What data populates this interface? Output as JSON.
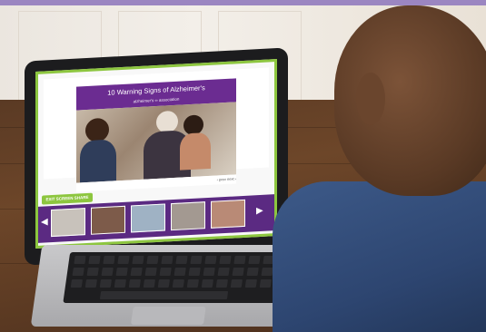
{
  "slide": {
    "title": "10 Warning Signs of Alzheimer's",
    "logo_text": "alzheimer's ∞ association",
    "footer": "‹ prev   next ›"
  },
  "controls": {
    "exit_label": "EXIT SCREEN SHARE",
    "left_arrow": "◀",
    "right_arrow": "▶"
  },
  "colors": {
    "brand_purple": "#6b2c91",
    "accent_green": "#8dc63f",
    "top_band": "#9b86c1"
  }
}
